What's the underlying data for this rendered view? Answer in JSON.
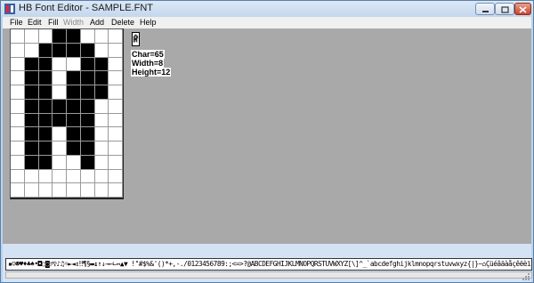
{
  "window": {
    "title": "HB Font Editor - SAMPLE.FNT",
    "icons": {
      "app": "app-icon",
      "minimize": "minimize-icon",
      "maximize": "maximize-icon",
      "close": "close-icon"
    }
  },
  "menu": {
    "items": [
      {
        "label": "File",
        "enabled": true
      },
      {
        "label": "Edit",
        "enabled": true
      },
      {
        "label": "Fill",
        "enabled": true
      },
      {
        "label": "Width",
        "enabled": false
      },
      {
        "label": "Add",
        "enabled": true
      },
      {
        "label": "Delete",
        "enabled": true
      },
      {
        "label": "Help",
        "enabled": true
      }
    ]
  },
  "glyph": {
    "char_label": "Char=65",
    "width_label": "Width=8",
    "height_label": "Height=12",
    "pixels": [
      "00011000",
      "00111100",
      "01100110",
      "01101110",
      "01101110",
      "01111100",
      "01111100",
      "01101100",
      "01101100",
      "01100100",
      "00000000",
      "00000000"
    ]
  },
  "charset": {
    "strip_text": "▪☺☻♥♦♣♠•◘○◙♂♀♪♫☼►◄↕‼¶§▬↨↑↓→←∟↔▲▼ !\"#$%&'()*+,-./0123456789:;<=>?@ABCDEFGHIJKLMNOPQRSTUVWXYZ[\\]^_`abcdefghijklmnopqrstuvwxyz{|}~⌂ÇüéâäàåçêëèïîìÄÅÉ"
  },
  "colors": {
    "pixel_on": "#000000",
    "pixel_off": "#ffffff",
    "client_bg": "#a9a9a9",
    "selected_char_bg": "#3a3a3a"
  }
}
